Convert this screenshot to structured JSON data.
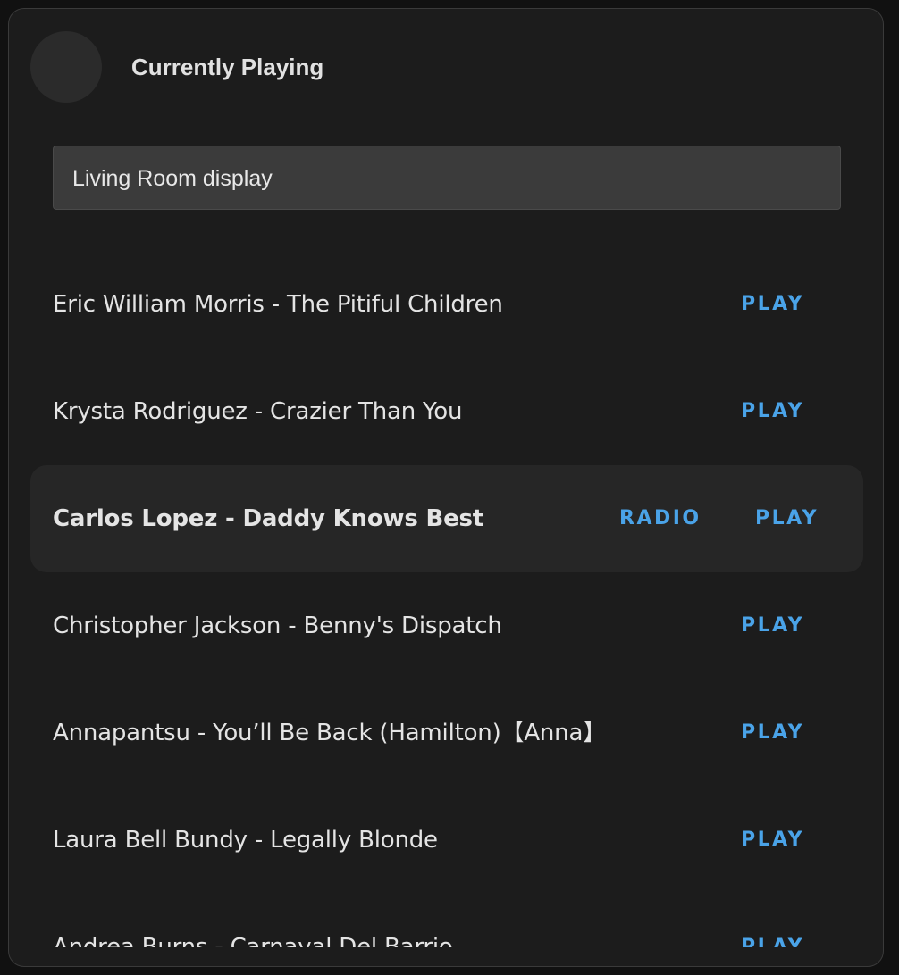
{
  "header": {
    "title": "Currently Playing"
  },
  "device_selector": {
    "value": "Living Room display"
  },
  "playlist": [
    {
      "title": "Eric William Morris - The Pitiful Children",
      "play_label": "PLAY"
    },
    {
      "title": "Krysta Rodriguez - Crazier Than You",
      "play_label": "PLAY"
    },
    {
      "title": "Carlos Lopez - Daddy Knows Best",
      "radio_label": "RADIO",
      "play_label": "PLAY",
      "active": true
    },
    {
      "title": "Christopher Jackson - Benny's Dispatch",
      "play_label": "PLAY"
    },
    {
      "title": "Annapantsu - You’ll Be Back (Hamilton)【Anna】",
      "play_label": "PLAY"
    },
    {
      "title": "Laura Bell Bundy - Legally Blonde",
      "play_label": "PLAY"
    },
    {
      "title": "Andrea Burns - Carnaval Del Barrio",
      "play_label": "PLAY"
    }
  ],
  "colors": {
    "accent": "#4aa3e8",
    "card_background": "#1c1c1c",
    "active_row": "#262626"
  }
}
